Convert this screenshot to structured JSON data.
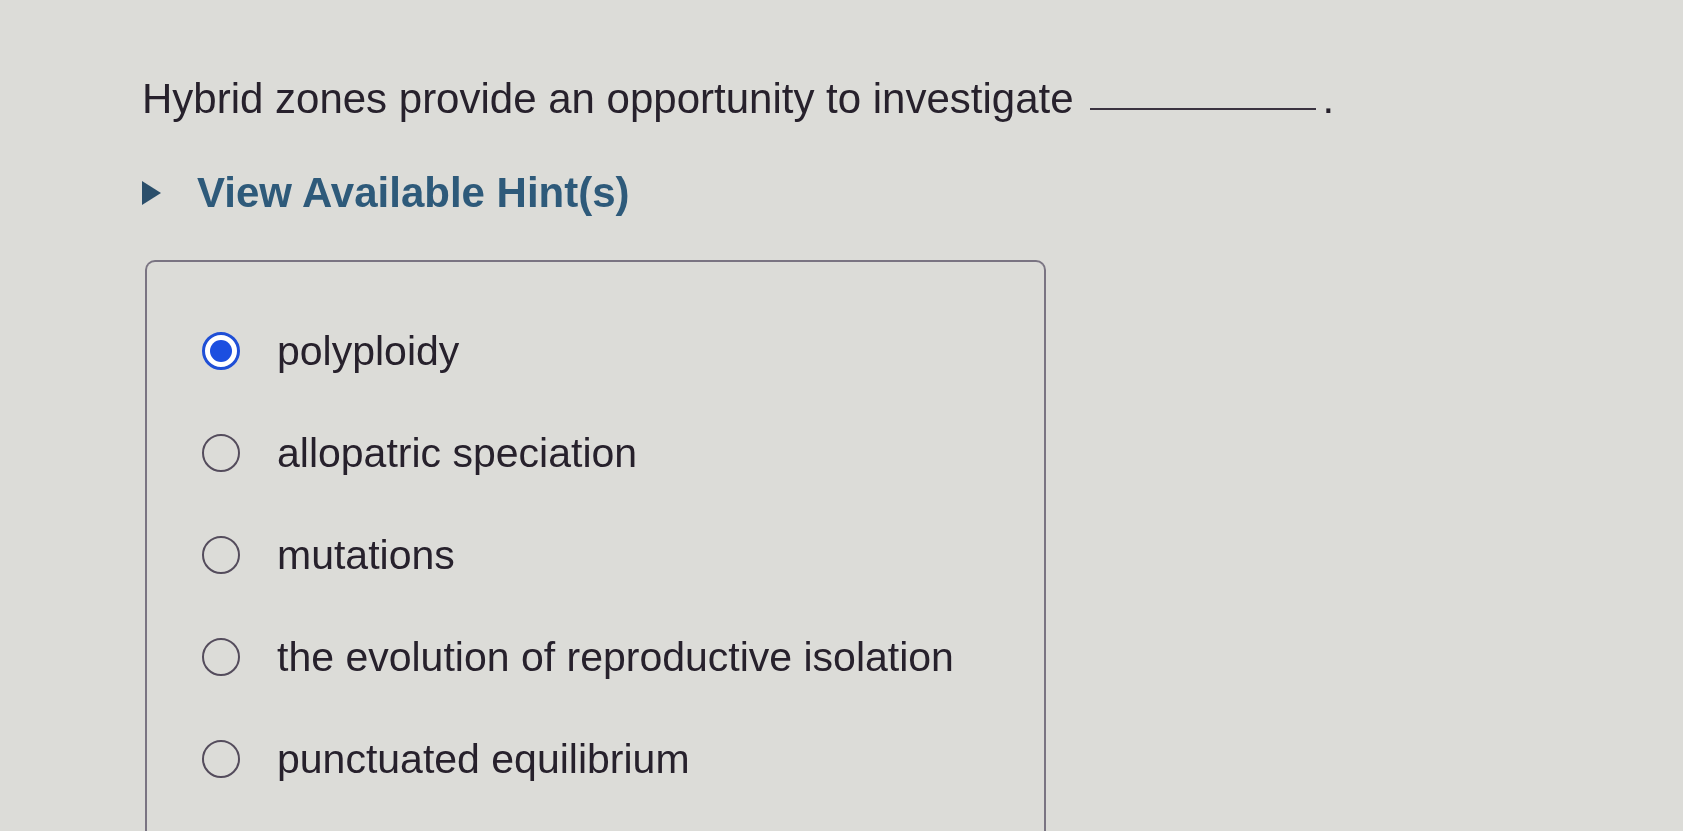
{
  "question": {
    "parts": [
      {
        "kind": "text",
        "text": "Hybrid zones provide an opportunity to investigate"
      },
      {
        "kind": "blank"
      },
      {
        "kind": "text",
        "text": "."
      }
    ]
  },
  "hint": {
    "label": "View Available Hint(s)",
    "expanded": false
  },
  "options": [
    {
      "label": "polyploidy",
      "selected": true
    },
    {
      "label": "allopatric speciation",
      "selected": false
    },
    {
      "label": "mutations",
      "selected": false
    },
    {
      "label": "the evolution of reproductive isolation",
      "selected": false
    },
    {
      "label": "punctuated equilibrium",
      "selected": false
    }
  ]
}
